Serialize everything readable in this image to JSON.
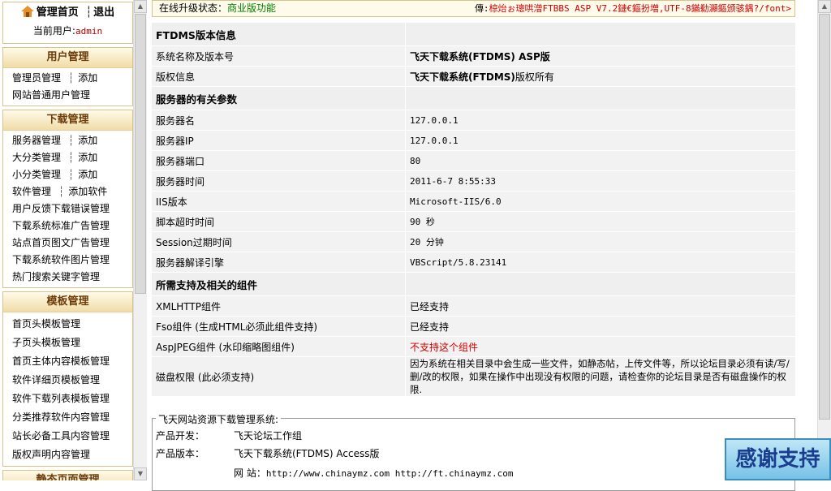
{
  "sidebar": {
    "top": {
      "home_label": "管理首页",
      "divider": "┆",
      "logout_label": "退出",
      "current_user_label": "当前用户:",
      "current_user": "admin"
    },
    "user_section": {
      "title": "用户管理",
      "rows": [
        {
          "a": "管理员管理",
          "b": "添加"
        },
        {
          "a": "网站普通用户管理",
          "b": ""
        }
      ]
    },
    "download_section": {
      "title": "下载管理",
      "rows": [
        {
          "a": "服务器管理",
          "b": "添加"
        },
        {
          "a": "大分类管理",
          "b": "添加"
        },
        {
          "a": "小分类管理",
          "b": "添加"
        },
        {
          "a": "软件管理",
          "b": "添加软件"
        },
        {
          "a": "用户反馈下载错误管理",
          "b": ""
        },
        {
          "a": "下载系统标准广告管理",
          "b": ""
        },
        {
          "a": "站点首页图文广告管理",
          "b": ""
        },
        {
          "a": "下载系统软件图片管理",
          "b": ""
        },
        {
          "a": "热门搜索关键字管理",
          "b": ""
        }
      ]
    },
    "template_section": {
      "title": "模板管理",
      "rows": [
        {
          "a": "首页头模板管理"
        },
        {
          "a": "子页头模板管理"
        },
        {
          "a": "首页主体内容模板管理"
        },
        {
          "a": "软件详细页模板管理"
        },
        {
          "a": "软件下载列表模板管理"
        },
        {
          "a": "分类推荐软件内容管理"
        },
        {
          "a": "站长必备工具内容管理"
        },
        {
          "a": "版权声明内容管理"
        }
      ]
    },
    "static_section": {
      "title": "静态页面管理"
    },
    "separator": "┆"
  },
  "status": {
    "label": "在线升级状态：",
    "value": "商业版功能",
    "right_prefix": "傳:",
    "right_red": "椋炲ぉ璁哄潧FTBBS ASP V7.2鏈€鏂扮増,UTF-8鏋勬灦鏂颁骇鍝?/font>"
  },
  "info": {
    "sec1": "FTDMS版本信息",
    "rows1": [
      {
        "k": "系统名称及版本号",
        "v": "飞天下载系统(FTDMS) ASP版"
      },
      {
        "k": "版权信息",
        "v_bold": "飞天下载系统(FTDMS)",
        "v_rest": "版权所有"
      }
    ],
    "sec2": "服务器的有关参数",
    "rows2": [
      {
        "k": "服务器名",
        "v": "127.0.0.1"
      },
      {
        "k": "服务器IP",
        "v": "127.0.0.1"
      },
      {
        "k": "服务器端口",
        "v": "80"
      },
      {
        "k": "服务器时间",
        "v": "2011-6-7 8:55:33"
      },
      {
        "k": "IIS版本",
        "v": "Microsoft-IIS/6.0"
      },
      {
        "k": "脚本超时时间",
        "v": "90 秒"
      },
      {
        "k": "Session过期时间",
        "v": "20 分钟"
      },
      {
        "k": "服务器解译引擎",
        "v": "VBScript/5.8.23141"
      }
    ],
    "sec3": "所需支持及相关的组件",
    "rows3": [
      {
        "k": "XMLHTTP组件",
        "v": "已经支持"
      },
      {
        "k": "Fso组件 (生成HTML必须此组件支持)",
        "v": "已经支持"
      },
      {
        "k": "AspJPEG组件 (水印缩略图组件)",
        "v": "不支持这个组件"
      },
      {
        "k": "磁盘权限 (此必须支持)",
        "v": "因为系统在相关目录中会生成一些文件，如静态帖，上传文件等，所以论坛目录必须有读/写/删/改的权限，如果在操作中出现没有权限的问题，请检查你的论坛目录是否有磁盘操作的权限."
      }
    ]
  },
  "about": {
    "legend": "飞天网站资源下载管理系统:",
    "dev_label": "产品开发：",
    "dev_value": "飞天论坛工作组",
    "ver_label": "产品版本：",
    "ver_value": "飞天下载系统(FTDMS) Access版",
    "site_label": "网 站：",
    "site_value": "http://www.chinaymz.com http://ft.chinaymz.com"
  },
  "badge": {
    "text": "感谢支持"
  },
  "colors": {
    "accent": "#6b3b08",
    "status_green": "#008000",
    "warn_red": "#d00000",
    "border": "#d9c38c"
  }
}
